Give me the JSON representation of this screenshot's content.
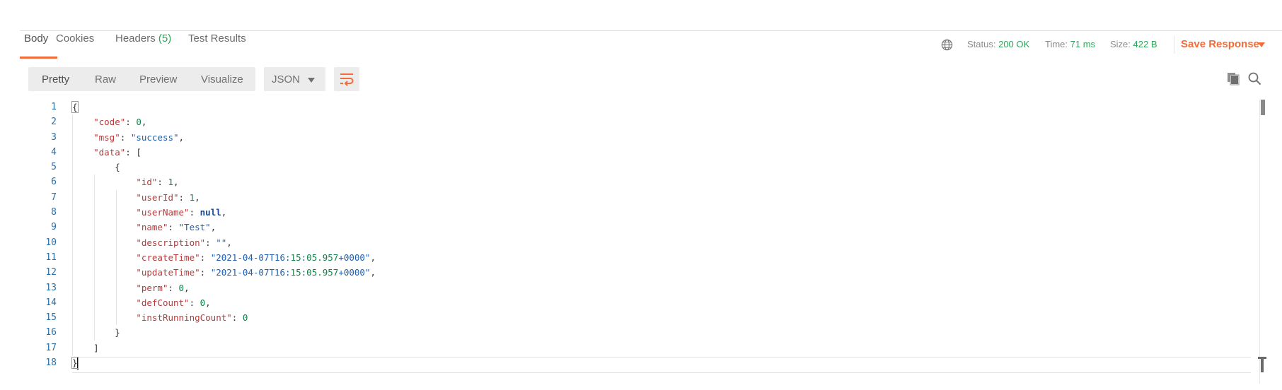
{
  "tabs": [
    {
      "label": "Body",
      "active": true
    },
    {
      "label": "Cookies"
    },
    {
      "label": "Headers",
      "count": "(5)"
    },
    {
      "label": "Test Results"
    }
  ],
  "response_meta": {
    "status_label": "Status:",
    "status_value": "200 OK",
    "time_label": "Time:",
    "time_value": "71 ms",
    "size_label": "Size:",
    "size_value": "422 B",
    "save_label": "Save Response"
  },
  "view_modes": [
    "Pretty",
    "Raw",
    "Preview",
    "Visualize"
  ],
  "format": "JSON",
  "icons": {
    "globe": "globe-icon",
    "wrap": "wrap-lines-icon",
    "copy": "copy-icon",
    "search": "search-icon"
  },
  "colors": {
    "accent": "#f26b3a",
    "status_green": "#2fa35a",
    "json_key": "#b63a3a",
    "json_string": "#1f5fb0",
    "json_number": "#11804a"
  },
  "body_lines": [
    {
      "num": "1",
      "text": "{"
    },
    {
      "num": "2",
      "text": "    \"code\": 0,"
    },
    {
      "num": "3",
      "text": "    \"msg\": \"success\","
    },
    {
      "num": "4",
      "text": "    \"data\": ["
    },
    {
      "num": "5",
      "text": "        {"
    },
    {
      "num": "6",
      "text": "            \"id\": 1,"
    },
    {
      "num": "7",
      "text": "            \"userId\": 1,"
    },
    {
      "num": "8",
      "text": "            \"userName\": null,"
    },
    {
      "num": "9",
      "text": "            \"name\": \"Test\","
    },
    {
      "num": "10",
      "text": "            \"description\": \"\","
    },
    {
      "num": "11",
      "text": "            \"createTime\": \"2021-04-07T16:15:05.957+0000\","
    },
    {
      "num": "12",
      "text": "            \"updateTime\": \"2021-04-07T16:15:05.957+0000\","
    },
    {
      "num": "13",
      "text": "            \"perm\": 0,"
    },
    {
      "num": "14",
      "text": "            \"defCount\": 0,"
    },
    {
      "num": "15",
      "text": "            \"instRunningCount\": 0"
    },
    {
      "num": "16",
      "text": "        }"
    },
    {
      "num": "17",
      "text": "    ]"
    },
    {
      "num": "18",
      "text": "}"
    }
  ]
}
